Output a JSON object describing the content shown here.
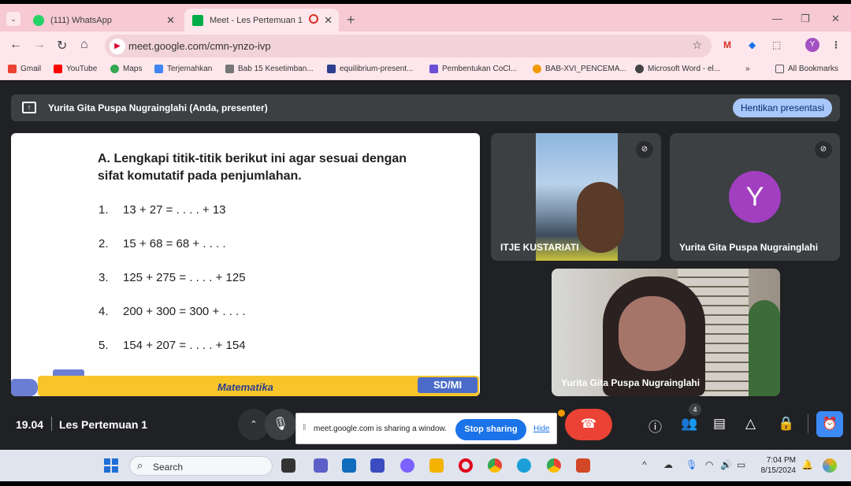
{
  "browser": {
    "tabs": [
      {
        "label": "(111) WhatsApp",
        "active": false
      },
      {
        "label": "Meet - Les Pertemuan 1",
        "active": true
      }
    ],
    "url": "meet.google.com/cmn-ynzo-ivp",
    "profile_initial": "Y",
    "bookmarks": [
      {
        "label": "Gmail",
        "icon": "gmail-icon"
      },
      {
        "label": "YouTube",
        "icon": "youtube-icon"
      },
      {
        "label": "Maps",
        "icon": "maps-icon"
      },
      {
        "label": "Terjemahkan",
        "icon": "translate-icon"
      },
      {
        "label": "Bab 15 Kesetimban...",
        "icon": "page-icon"
      },
      {
        "label": "equilibrium-present...",
        "icon": "pb-icon"
      },
      {
        "label": "Pembentukan CoCl...",
        "icon": "s-icon"
      },
      {
        "label": "BAB-XVI_PENCEMA...",
        "icon": "doc-icon"
      },
      {
        "label": "Microsoft Word - el...",
        "icon": "globe-icon"
      }
    ],
    "more_bookmarks": "»",
    "all_bookmarks": "All Bookmarks"
  },
  "meet": {
    "presenter_bar": {
      "text": "Yurita Gita Puspa Nugrainglahi (Anda, presenter)",
      "stop_label": "Hentikan presentasi"
    },
    "slide": {
      "heading": "A. Lengkapi titik-titik berikut ini agar sesuai dengan sifat komutatif pada penjumlahan.",
      "problems": [
        {
          "num": "1.",
          "text": "13 + 27 = . . . . + 13"
        },
        {
          "num": "2.",
          "text": "15 + 68 = 68 + . . . ."
        },
        {
          "num": "3.",
          "text": "125 + 275 = . . . . + 125"
        },
        {
          "num": "4.",
          "text": "200 + 300 = 300 + . . . ."
        },
        {
          "num": "5.",
          "text": "154 + 207 = . . . . + 154"
        }
      ],
      "subject": "Matematika",
      "level": "SD/MI"
    },
    "participants": [
      {
        "name": "ITJE KUSTARIATI"
      },
      {
        "name": "Yurita Gita Puspa Nugrainglahi",
        "initial": "Y"
      },
      {
        "name": "Yurita Gita Puspa Nugrainglahi"
      }
    ],
    "bottom": {
      "time": "19.04",
      "meeting_name": "Les Pertemuan 1",
      "people_count": "4",
      "share_msg": "meet.google.com is sharing a window.",
      "stop_sharing": "Stop sharing",
      "hide": "Hide"
    }
  },
  "taskbar": {
    "search_label": "Search",
    "time": "7:04 PM",
    "date": "8/15/2024"
  }
}
